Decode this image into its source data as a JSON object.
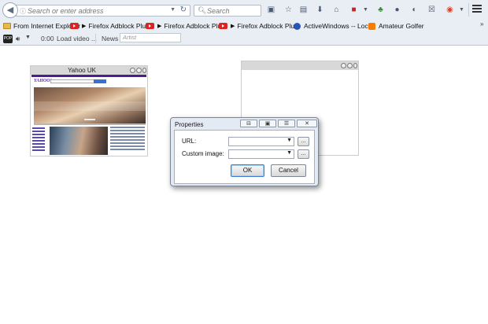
{
  "nav": {
    "url_placeholder": "Search or enter address",
    "search_placeholder": "Search"
  },
  "bookmarks": [
    {
      "label": "From Internet Explorer",
      "icon": "folder-icon"
    },
    {
      "label": "Firefox Adblock Plu...",
      "icon": "youtube-icon"
    },
    {
      "label": "Firefox Adblock Plu...",
      "icon": "youtube-icon"
    },
    {
      "label": "Firefox Adblock Plu...",
      "icon": "youtube-icon"
    },
    {
      "label": "ActiveWindows -- Loc...",
      "icon": "activewindows-icon"
    },
    {
      "label": "Amateur Golfer",
      "icon": "blogger-icon"
    }
  ],
  "videobar": {
    "logo": "POP",
    "time": "0:00",
    "load_label": "Load video ...",
    "news_label": "News",
    "artist_placeholder": "Artist"
  },
  "thumbnail": {
    "title": "Yahoo UK",
    "logo": "YAHOO!"
  },
  "dialog": {
    "title": "Properties",
    "url_label": "URL:",
    "url_value": "",
    "image_label": "Custom image:",
    "image_value": "",
    "browse_label": "...",
    "ok_label": "OK",
    "cancel_label": "Cancel"
  },
  "colors": {
    "chrome_bg": "#e9eef5",
    "yahoo_purple": "#4b1d8f",
    "youtube_red": "#dd2222",
    "ok_focus": "#3d7bd9"
  }
}
